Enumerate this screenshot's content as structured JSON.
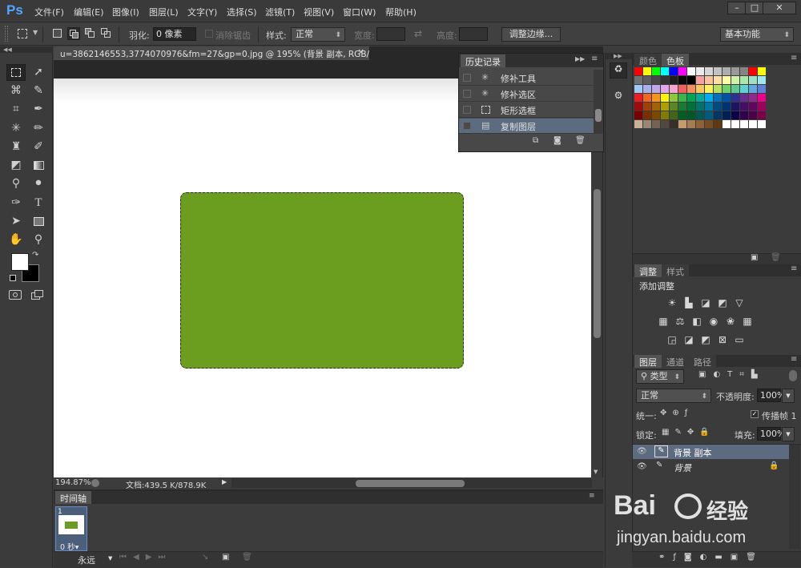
{
  "app": {
    "logo": "Ps"
  },
  "menu": [
    "文件(F)",
    "编辑(E)",
    "图像(I)",
    "图层(L)",
    "文字(Y)",
    "选择(S)",
    "滤镜(T)",
    "视图(V)",
    "窗口(W)",
    "帮助(H)"
  ],
  "window_buttons": [
    "–",
    "□",
    "✕"
  ],
  "options": {
    "feather_label": "羽化:",
    "feather_value": "0 像素",
    "antialias_label": "消除锯齿",
    "style_label": "样式:",
    "style_value": "正常",
    "width_label": "宽度:",
    "height_label": "高度:",
    "refine_edge": "调整边缘...",
    "workspace": "基本功能"
  },
  "document": {
    "tab_title": "u=3862146553,3774070976&fm=27&gp=0.jpg @ 195% (背景 副本, RGB/8#) *",
    "fill_color": "#6b9e1f",
    "zoom": "194.87%",
    "doc_size": "文档:439.5 K/878.9K"
  },
  "history": {
    "title": "历史记录",
    "items": [
      {
        "label": "修补工具",
        "icon": "patch-tool-icon"
      },
      {
        "label": "修补选区",
        "icon": "patch-tool-icon"
      },
      {
        "label": "矩形选框",
        "icon": "marquee-icon"
      },
      {
        "label": "复制图层",
        "icon": "layer-icon"
      }
    ]
  },
  "timeline": {
    "title": "时间轴",
    "frame_number": "1",
    "frame_delay": "0 秒▾",
    "loop": "永远"
  },
  "swatches_panel": {
    "tabs": [
      "颜色",
      "色板"
    ],
    "colors": [
      "#ff0000",
      "#ffff00",
      "#00ff00",
      "#00ffff",
      "#0000ff",
      "#ff00ff",
      "#ffffff",
      "#ebebeb",
      "#d6d6d6",
      "#c2c2c2",
      "#adadad",
      "#999999",
      "#858585",
      "#ff0000",
      "#ffff00",
      "#707070",
      "#5c5c5c",
      "#474747",
      "#333333",
      "#1f1f1f",
      "#0a0a0a",
      "#000000",
      "#f8a0a0",
      "#f8c4a0",
      "#fcdea0",
      "#fffaa8",
      "#d0f0a8",
      "#a8e8a8",
      "#a0e0c0",
      "#a0e8f0",
      "#a0c8f0",
      "#a8b0e8",
      "#c0a8e8",
      "#e0a8e8",
      "#f0a8d0",
      "#f06060",
      "#f09060",
      "#f8c860",
      "#fff060",
      "#b8e060",
      "#70d070",
      "#60c890",
      "#60d0d0",
      "#60a8e0",
      "#6080d8",
      "#ed1c24",
      "#f26522",
      "#f7941d",
      "#fff200",
      "#8dc63f",
      "#39b54a",
      "#00a651",
      "#00a99d",
      "#00aeef",
      "#0072bc",
      "#0054a6",
      "#2e3192",
      "#662d91",
      "#92278f",
      "#ec008c",
      "#9e0b0f",
      "#a0410d",
      "#a3620a",
      "#aba000",
      "#598527",
      "#197b30",
      "#007236",
      "#00746b",
      "#0076a3",
      "#004a80",
      "#003471",
      "#1b1464",
      "#440e62",
      "#630460",
      "#9e005d",
      "#790000",
      "#7b2e00",
      "#7d4900",
      "#827b00",
      "#406618",
      "#005e20",
      "#005826",
      "#005952",
      "#005b7f",
      "#003663",
      "#002157",
      "#0d004c",
      "#32004b",
      "#4b0049",
      "#7b0046",
      "#c7b299",
      "#998675",
      "#736357",
      "#534741",
      "#37302a",
      "#c69c6d",
      "#a67c52",
      "#8c6239",
      "#754c24",
      "#603913",
      "#ffffff",
      "#ffffff",
      "#ffffff",
      "#ffffff",
      "#ffffff"
    ]
  },
  "adjustments": {
    "tabs": [
      "调整",
      "样式"
    ],
    "heading": "添加调整"
  },
  "layers": {
    "tabs": [
      "图层",
      "通道",
      "路径"
    ],
    "filter": "类型",
    "blend_mode": "正常",
    "opacity_label": "不透明度:",
    "opacity": "100%",
    "unify_label": "统一:",
    "propagate": "传播帧 1",
    "lock_label": "锁定:",
    "fill_label": "填充:",
    "fill": "100%",
    "items": [
      {
        "name": "背景 副本",
        "selected": true
      },
      {
        "name": "背景",
        "locked": true
      }
    ]
  },
  "watermark": {
    "brand": "Bai",
    "brand2": "经验",
    "url": "jingyan.baidu.com"
  }
}
